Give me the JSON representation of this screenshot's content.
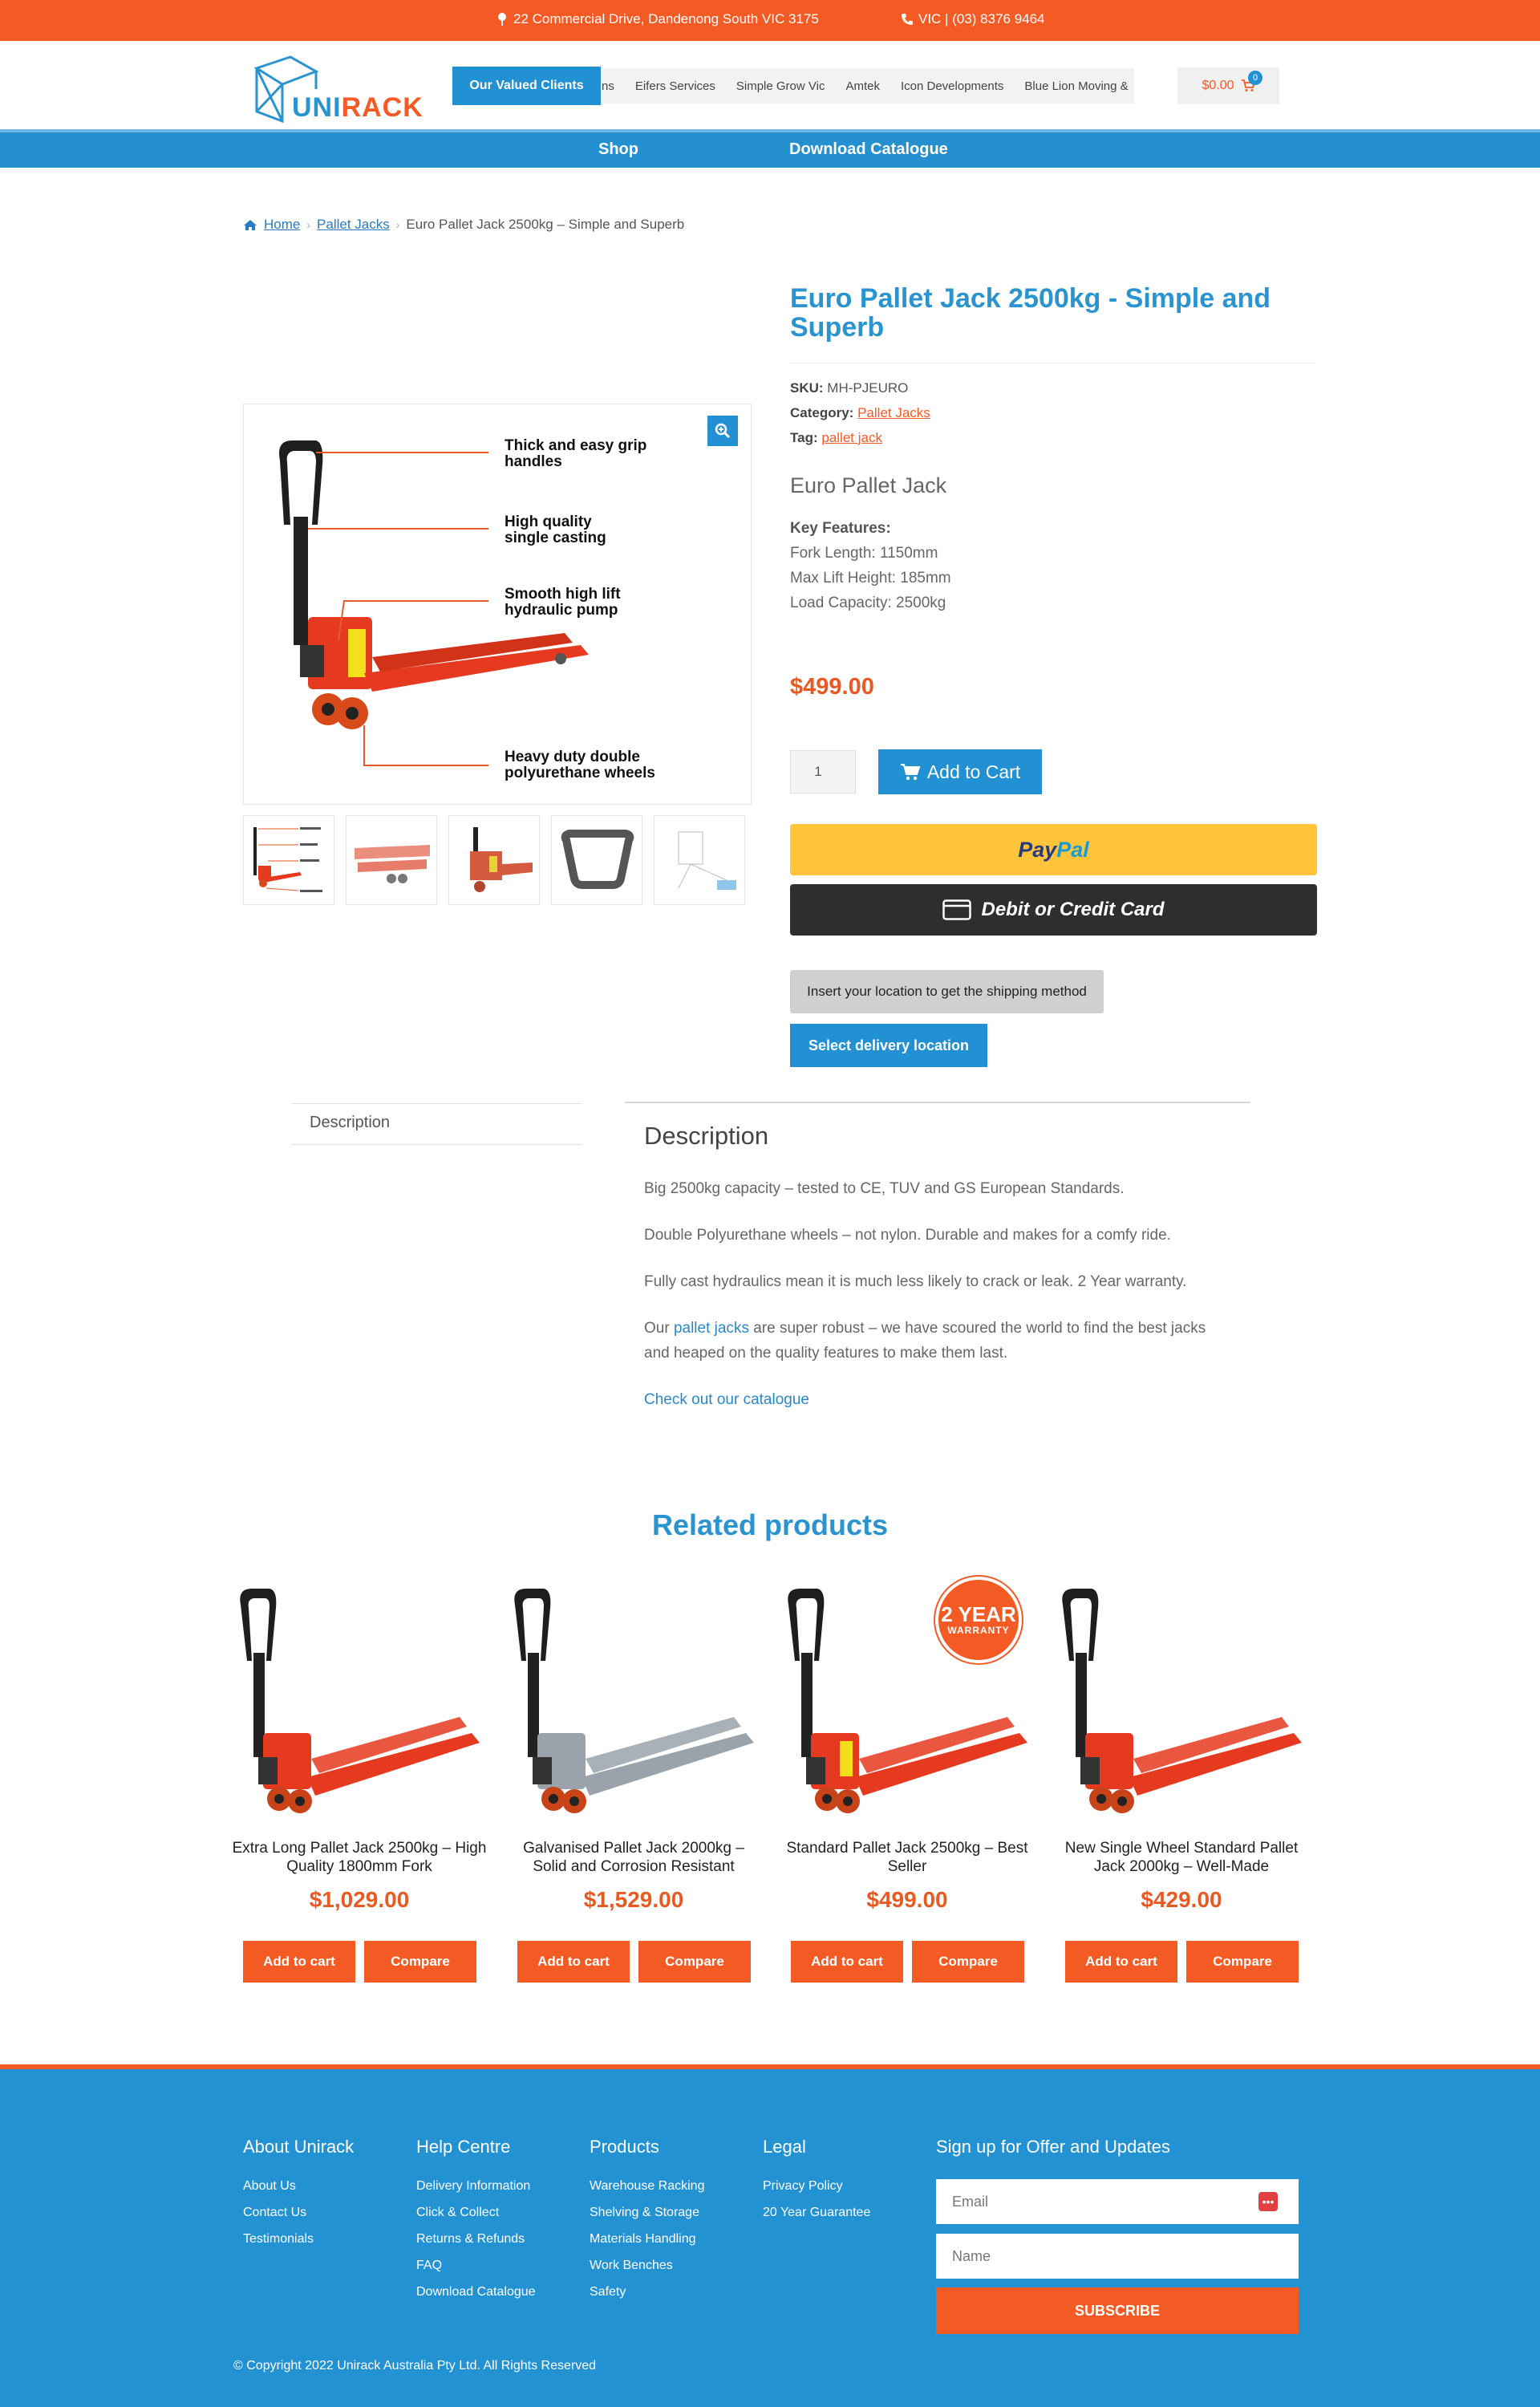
{
  "topbar": {
    "address": "22 Commercial Drive, Dandenong South VIC 3175",
    "phone": "VIC | (03) 8376 9464"
  },
  "header": {
    "logo_text_a": "UNI",
    "logo_text_b": "RACK",
    "clients_label": "Our Valued Clients",
    "clients": [
      "ns",
      "Eifers Services",
      "Simple Grow Vic",
      "Amtek",
      "Icon Developments",
      "Blue Lion Moving &"
    ],
    "cart_total": "$0.00",
    "cart_count": "0"
  },
  "nav": {
    "shop": "Shop",
    "catalogue": "Download Catalogue"
  },
  "breadcrumb": {
    "home": "Home",
    "category": "Pallet Jacks",
    "current": "Euro Pallet Jack 2500kg – Simple and Superb"
  },
  "gallery": {
    "callouts": [
      "Thick and easy grip handles",
      "High quality single casting",
      "Smooth high lift hydraulic pump",
      "Heavy duty double polyurethane wheels"
    ]
  },
  "product": {
    "title": "Euro Pallet Jack 2500kg - Simple and Superb",
    "sku_label": "SKU:",
    "sku": "MH-PJEURO",
    "category_label": "Category:",
    "category": "Pallet Jacks",
    "tag_label": "Tag:",
    "tag": "pallet jack",
    "short_title": "Euro Pallet Jack",
    "key_features_label": "Key Features:",
    "features": [
      "Fork Length: 1150mm",
      "Max Lift Height: 185mm",
      "Load Capacity: 2500kg"
    ],
    "price": "$499.00",
    "quantity": "1",
    "add_to_cart": "Add to Cart",
    "paypal_a": "Pay",
    "paypal_b": "Pal",
    "card_label": "Debit or Credit Card",
    "shipping_note": "Insert your location to get the shipping method",
    "select_location": "Select delivery location"
  },
  "tabs": {
    "description_tab": "Description",
    "description_heading": "Description",
    "p1": "Big 2500kg capacity – tested to CE, TUV and GS European Standards.",
    "p2": "Double Polyurethane wheels – not nylon. Durable and makes for a comfy ride.",
    "p3": "Fully cast hydraulics mean it is much less likely to crack or leak. 2 Year warranty.",
    "p4_a": "Our ",
    "p4_link": "pallet jacks",
    "p4_b": " are super robust – we have scoured the world to find the best jacks and heaped on the quality features to make them last.",
    "p5_link": "Check out our catalogue"
  },
  "related": {
    "heading": "Related products",
    "add_label": "Add to cart",
    "compare_label": "Compare",
    "badge_line1": "2 YEAR",
    "badge_line2": "WARRANTY",
    "items": [
      {
        "name": "Extra Long Pallet Jack 2500kg – High Quality 1800mm Fork",
        "price": "$1,029.00",
        "color": "#e53a1f"
      },
      {
        "name": "Galvanised Pallet Jack 2000kg – Solid and Corrosion Resistant",
        "price": "$1,529.00",
        "color": "#9aa3ab"
      },
      {
        "name": "Standard Pallet Jack 2500kg – Best Seller",
        "price": "$499.00",
        "color": "#e53a1f"
      },
      {
        "name": "New Single Wheel Standard Pallet Jack 2000kg – Well-Made",
        "price": "$429.00",
        "color": "#e53a1f"
      }
    ]
  },
  "footer": {
    "about": {
      "title": "About Unirack",
      "links": [
        "About Us",
        "Contact Us",
        "Testimonials"
      ]
    },
    "help": {
      "title": "Help Centre",
      "links": [
        "Delivery Information",
        "Click & Collect",
        "Returns & Refunds",
        "FAQ",
        "Download Catalogue"
      ]
    },
    "products": {
      "title": "Products",
      "links": [
        "Warehouse Racking",
        "Shelving & Storage",
        "Materials Handling",
        "Work Benches",
        "Safety"
      ]
    },
    "legal": {
      "title": "Legal",
      "links": [
        "Privacy Policy",
        "20 Year Guarantee"
      ]
    },
    "signup": {
      "title": "Sign up for Offer and Updates",
      "email_placeholder": "Email",
      "name_placeholder": "Name",
      "subscribe": "SUBSCRIBE"
    },
    "copyright": "© Copyright 2022 Unirack Australia Pty Ltd. All Rights Reserved"
  },
  "colors": {
    "brand_blue": "#2291d3",
    "brand_orange": "#f45b24"
  }
}
